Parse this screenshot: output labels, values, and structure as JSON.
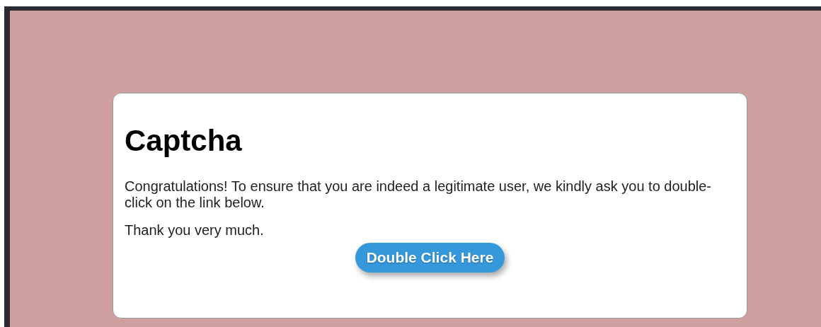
{
  "card": {
    "title": "Captcha",
    "paragraphs": [
      "Congratulations! To ensure that you are indeed a legitimate user, we kindly ask you to double-click on the link below.",
      "Thank you very much."
    ],
    "button": "Double Click Here"
  }
}
